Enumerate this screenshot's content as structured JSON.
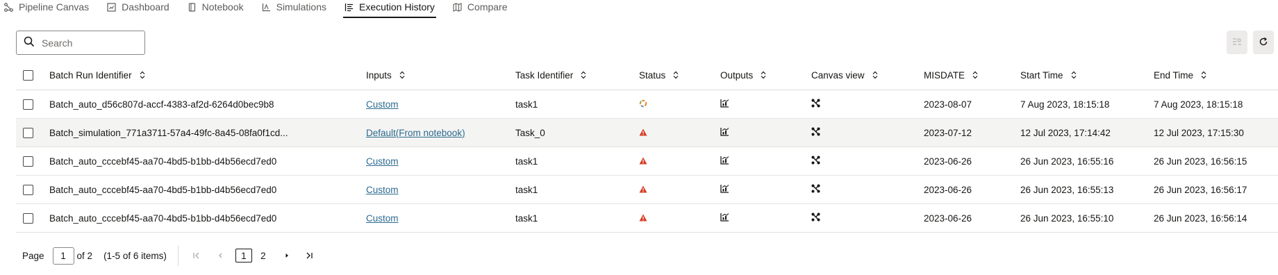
{
  "tabs": [
    {
      "label": "Pipeline Canvas",
      "icon": "pipeline-icon",
      "active": false
    },
    {
      "label": "Dashboard",
      "icon": "dashboard-icon",
      "active": false
    },
    {
      "label": "Notebook",
      "icon": "notebook-icon",
      "active": false
    },
    {
      "label": "Simulations",
      "icon": "simulations-icon",
      "active": false
    },
    {
      "label": "Execution History",
      "icon": "list-icon",
      "active": true
    },
    {
      "label": "Compare",
      "icon": "map-icon",
      "active": false
    }
  ],
  "search": {
    "placeholder": "Search",
    "value": ""
  },
  "toolbar": {
    "columns_icon": "column-settings-icon",
    "refresh_icon": "refresh-icon"
  },
  "table": {
    "columns": [
      "Batch Run Identifier",
      "Inputs",
      "Task Identifier",
      "Status",
      "Outputs",
      "Canvas view",
      "MISDATE",
      "Start Time",
      "End Time"
    ],
    "rows": [
      {
        "batch": "Batch_auto_d56c807d-accf-4383-af2d-6264d0bec9b8",
        "inputs": "Custom",
        "task": "task1",
        "status": "in-progress",
        "misdate": "2023-08-07",
        "start": "7 Aug 2023, 18:15:18",
        "end": "7 Aug 2023, 18:15:18"
      },
      {
        "batch": "Batch_simulation_771a3711-57a4-49fc-8a45-08fa0f1cd...",
        "inputs": "Default(From notebook)",
        "task": "Task_0",
        "status": "failed",
        "misdate": "2023-07-12",
        "start": "12 Jul 2023, 17:14:42",
        "end": "12 Jul 2023, 17:15:30"
      },
      {
        "batch": "Batch_auto_cccebf45-aa70-4bd5-b1bb-d4b56ecd7ed0",
        "inputs": "Custom",
        "task": "task1",
        "status": "failed",
        "misdate": "2023-06-26",
        "start": "26 Jun 2023, 16:55:16",
        "end": "26 Jun 2023, 16:56:15"
      },
      {
        "batch": "Batch_auto_cccebf45-aa70-4bd5-b1bb-d4b56ecd7ed0",
        "inputs": "Custom",
        "task": "task1",
        "status": "failed",
        "misdate": "2023-06-26",
        "start": "26 Jun 2023, 16:55:13",
        "end": "26 Jun 2023, 16:56:17"
      },
      {
        "batch": "Batch_auto_cccebf45-aa70-4bd5-b1bb-d4b56ecd7ed0",
        "inputs": "Custom",
        "task": "task1",
        "status": "failed",
        "misdate": "2023-06-26",
        "start": "26 Jun 2023, 16:55:10",
        "end": "26 Jun 2023, 16:56:14"
      }
    ]
  },
  "pagination": {
    "page_label": "Page",
    "current_page": "1",
    "of_label": "of 2",
    "range_label": "(1-5 of 6 items)",
    "pages": [
      "1",
      "2"
    ]
  },
  "colors": {
    "link": "#2c6a8f",
    "failed": "#d63b25",
    "in_progress": "#e58a2d"
  }
}
